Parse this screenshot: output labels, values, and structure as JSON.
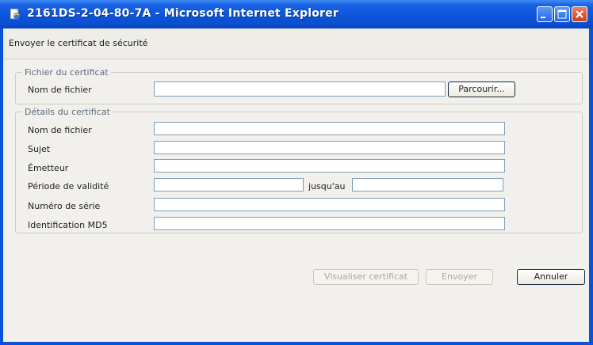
{
  "window": {
    "title": "2161DS-2-04-80-7A - Microsoft Internet Explorer",
    "icon": "ie-page-icon"
  },
  "header": {
    "title": "Envoyer le certificat de sécurité"
  },
  "certificate_file": {
    "legend": "Fichier du certificat",
    "filename_label": "Nom de fichier",
    "filename_value": "",
    "browse_label": "Parcourir..."
  },
  "certificate_details": {
    "legend": "Détails du certificat",
    "filename_label": "Nom de fichier",
    "subject_label": "Sujet",
    "issuer_label": "Émetteur",
    "validity_label": "Période de validité",
    "until_label": "jusqu'au",
    "serial_label": "Numéro de série",
    "md5_label": "Identification MD5"
  },
  "buttons": {
    "view_certificate": "Visualiser certificat",
    "send": "Envoyer",
    "cancel": "Annuler"
  }
}
